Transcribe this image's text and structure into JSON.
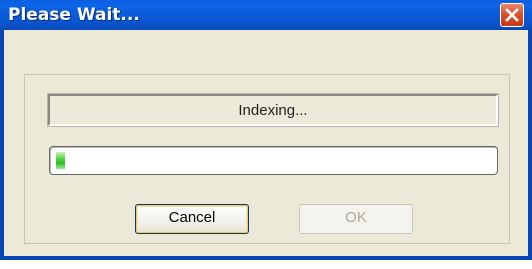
{
  "window": {
    "title": "Please Wait...",
    "close_icon": "close-x-icon"
  },
  "status": {
    "text": "Indexing..."
  },
  "progress": {
    "fraction": 0.02,
    "color": "#2fbf22"
  },
  "buttons": {
    "cancel_label": "Cancel",
    "ok_label": "OK",
    "ok_enabled": false
  },
  "colors": {
    "titlebar": "#0a5bd8",
    "close_button": "#d8532f",
    "dialog_background": "#ece9d8"
  }
}
